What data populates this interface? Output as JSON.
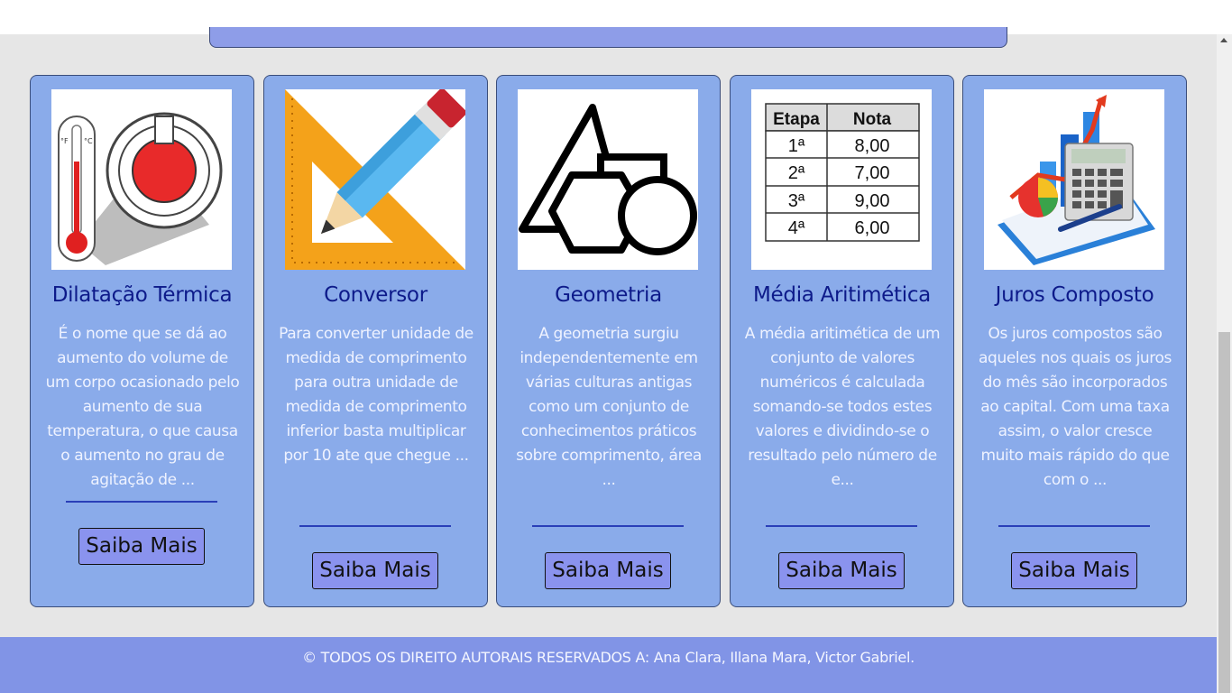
{
  "cards": [
    {
      "title": "Dilatação Térmica",
      "text": "É o nome que se dá ao aumento do volume de um corpo ocasionado pelo aumento de sua temperatura, o que causa o aumento no grau de agitação de ...",
      "button": "Saiba Mais",
      "icon": "thermometer-image"
    },
    {
      "title": "Conversor",
      "text": "Para converter unidade de medida de comprimento para outra unidade de medida de comprimento inferior basta multiplicar por 10 ate que chegue ...",
      "button": "Saiba Mais",
      "icon": "ruler-pencil-image"
    },
    {
      "title": "Geometria",
      "text": "A geometria surgiu independentemente em várias culturas antigas como um conjunto de conhecimentos práticos sobre comprimento, área ...",
      "button": "Saiba Mais",
      "icon": "geometric-shapes-image"
    },
    {
      "title": "Média Aritimética",
      "text": "A média aritimética de um conjunto de valores numéricos é calculada somando-se todos estes valores e dividindo-se o resultado pelo número de e...",
      "button": "Saiba Mais",
      "icon": "grades-table-image",
      "table": {
        "headers": [
          "Etapa",
          "Nota"
        ],
        "rows": [
          [
            "1ª",
            "8,00"
          ],
          [
            "2ª",
            "7,00"
          ],
          [
            "3ª",
            "9,00"
          ],
          [
            "4ª",
            "6,00"
          ]
        ]
      }
    },
    {
      "title": "Juros Composto",
      "text": "Os juros compostos são aqueles nos quais os juros do mês são incorporados ao capital. Com uma taxa assim, o valor cresce muito mais rápido do que com o ...",
      "button": "Saiba Mais",
      "icon": "finance-calculator-image"
    }
  ],
  "footer": {
    "text": "© TODOS OS DIREITO AUTORAIS RESERVADOS A: Ana Clara, Illana Mara, Victor Gabriel."
  },
  "colors": {
    "card_bg": "#8aabea",
    "title": "#0d1a8a",
    "button_bg": "#8a93ee",
    "footer_bg": "#8194e6"
  }
}
